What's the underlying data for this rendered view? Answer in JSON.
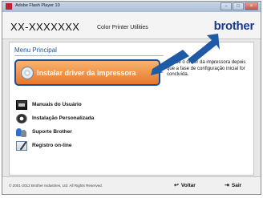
{
  "window": {
    "title": "Adobe Flash Player 10",
    "controls": {
      "minimize": "–",
      "maximize": "□",
      "close": "×"
    }
  },
  "header": {
    "model": "XX-XXXXXXX",
    "subtitle": "Color Printer Utilities",
    "brand": "brother"
  },
  "menu": {
    "title": "Menu Principal",
    "primary": {
      "label": "Instalar driver da impressora",
      "description": "Instale o driver da impressora depois que a fase de configuração inicial for concluída."
    },
    "items": [
      {
        "label": "Manuais do Usuário",
        "icon": "manual-icon"
      },
      {
        "label": "Instalação Personalizada",
        "icon": "gear-icon"
      },
      {
        "label": "Suporte Brother",
        "icon": "support-icon"
      },
      {
        "label": "Registro on-line",
        "icon": "register-icon"
      }
    ]
  },
  "footer": {
    "copyright": "© 2001-2012 Brother Industries, Ltd. All Rights Reserved.",
    "back_label": "Voltar",
    "exit_label": "Sair"
  },
  "colors": {
    "brand": "#1b3a8c",
    "accent_orange": "#e8772b",
    "highlight_border": "#1b4f9e",
    "menu_title": "#1f4fa8",
    "arrow": "#1f5aa6"
  }
}
